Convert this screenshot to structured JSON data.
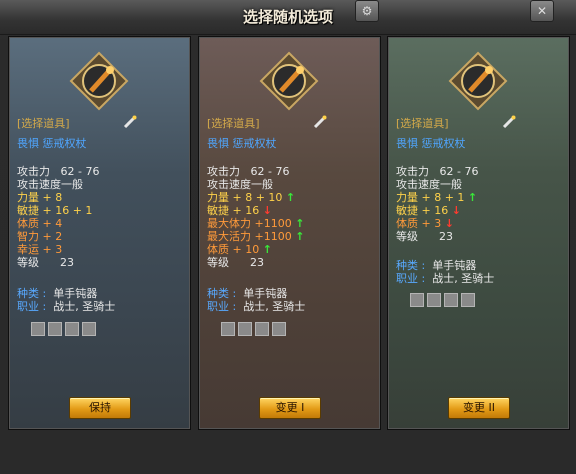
{
  "dialog": {
    "title": "选择随机选项"
  },
  "panels": [
    {
      "item_label": "[选择道具]",
      "item_name": "畏惧 惩戒权杖",
      "stats": [
        {
          "k": "攻击力",
          "v": "62 -  76",
          "color": "white"
        },
        {
          "k": "攻击速度一般",
          "v": "",
          "color": "white"
        },
        {
          "k": "力量 + 8",
          "v": "",
          "color": "yellow"
        },
        {
          "k": "敏捷 + 16 +  1",
          "v": "",
          "color": "yellow"
        },
        {
          "k": "体质 + 4",
          "v": "",
          "color": "orange"
        },
        {
          "k": "智力 + 2",
          "v": "",
          "color": "orange"
        },
        {
          "k": "幸运 + 3",
          "v": "",
          "color": "orange"
        },
        {
          "k": "等级",
          "v": "23",
          "color": "white"
        }
      ],
      "kind_label": "种类 :",
      "kind_value": "单手钝器",
      "job_label": "职业 :",
      "job_value": "战士, 圣骑士",
      "button": "保持"
    },
    {
      "item_label": "[选择道具]",
      "item_name": "畏惧 惩戒权杖",
      "stats": [
        {
          "k": "攻击力",
          "v": "62 -  76",
          "color": "white"
        },
        {
          "k": "攻击速度一般",
          "v": "",
          "color": "white"
        },
        {
          "k": "力量 + 8 + 10",
          "v": "",
          "color": "yellow",
          "arrow": "up"
        },
        {
          "k": "敏捷 + 16",
          "v": "",
          "color": "yellow",
          "arrow": "down"
        },
        {
          "k": "最大体力 +1100",
          "v": "",
          "color": "orange",
          "arrow": "up"
        },
        {
          "k": "最大活力 +1100",
          "v": "",
          "color": "orange",
          "arrow": "up"
        },
        {
          "k": "体质 + 10",
          "v": "",
          "color": "orange",
          "arrow": "up"
        },
        {
          "k": "等级",
          "v": "23",
          "color": "white"
        }
      ],
      "kind_label": "种类 :",
      "kind_value": "单手钝器",
      "job_label": "职业 :",
      "job_value": "战士, 圣骑士",
      "button": "变更 I"
    },
    {
      "item_label": "[选择道具]",
      "item_name": "畏惧 惩戒权杖",
      "stats": [
        {
          "k": "攻击力",
          "v": "62 -  76",
          "color": "white"
        },
        {
          "k": "攻击速度一般",
          "v": "",
          "color": "white"
        },
        {
          "k": "力量 + 8 + 1",
          "v": "",
          "color": "yellow",
          "arrow": "up"
        },
        {
          "k": "敏捷 + 16",
          "v": "",
          "color": "yellow",
          "arrow": "down"
        },
        {
          "k": "体质 + 3",
          "v": "",
          "color": "orange",
          "arrow": "down"
        },
        {
          "k": "等级",
          "v": "23",
          "color": "white"
        }
      ],
      "kind_label": "种类 :",
      "kind_value": "单手钝器",
      "job_label": "职业 :",
      "job_value": "战士, 圣骑士",
      "button": "变更 II"
    }
  ],
  "icons": {
    "weapon": "scepter-icon",
    "up": "↑",
    "down": "↓"
  },
  "colors": {
    "accent": "#ffd24a",
    "name_blue": "#4fa6ff",
    "up": "#39e639",
    "down": "#ff3b2f"
  }
}
